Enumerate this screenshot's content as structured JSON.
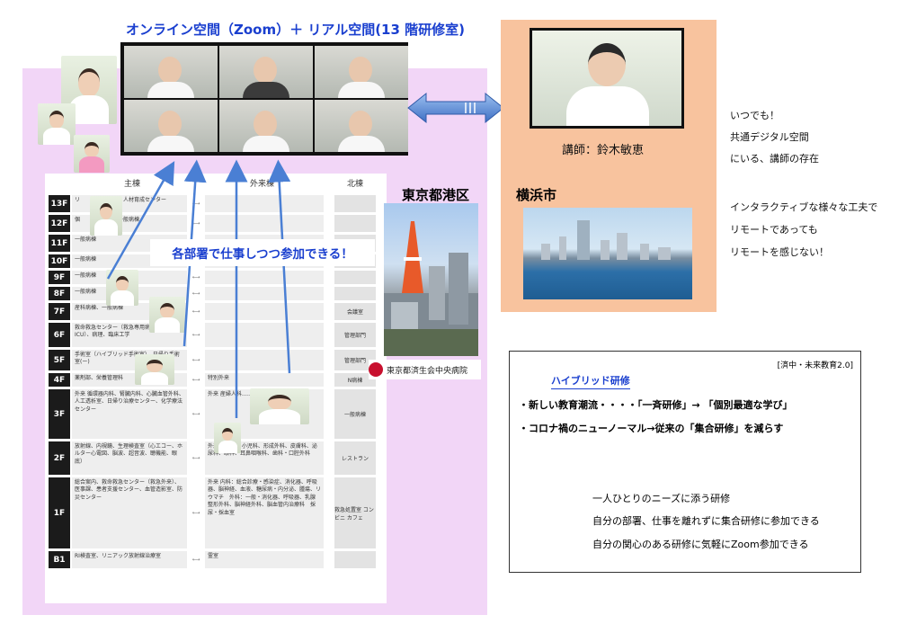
{
  "title": "オンライン空間（Zoom）＋ リアル空間(13 階研修室)",
  "callout": "各部署で仕事しつつ参加できる！",
  "lecturer": {
    "label": "講師：鈴木敏恵",
    "icon": "video-call-screen"
  },
  "yokohama": {
    "label": "横浜市"
  },
  "tokyo": {
    "label": "東京都港区",
    "hospital_logo": "東京都済生会中央病院"
  },
  "side_text": [
    "いつでも！",
    "共通デジタル空間",
    "にいる、講師の存在",
    "インタラクティブな様々な工夫で",
    "リモートであっても",
    "リモートを感じない！"
  ],
  "floor_map": {
    "headers": {
      "main": "主棟",
      "outpatient": "外来棟",
      "north": "北棟"
    },
    "floors": [
      {
        "label": "13F",
        "main": "リ　　　　り回廊、人材育成センター",
        "out": "",
        "north": ""
      },
      {
        "label": "12F",
        "main": "個　　　　　　　一般病棟",
        "out": "",
        "north": ""
      },
      {
        "label": "11F",
        "main": "一般病棟",
        "out": "",
        "north": ""
      },
      {
        "label": "10F",
        "main": "一般病棟",
        "out": "",
        "north": ""
      },
      {
        "label": "9F",
        "main": "一般病棟",
        "out": "",
        "north": ""
      },
      {
        "label": "8F",
        "main": "一般病棟",
        "out": "",
        "north": ""
      },
      {
        "label": "7F",
        "main": "産科病棟、一般病棟",
        "out": "",
        "north": "会議室"
      },
      {
        "label": "6F",
        "main": "救命救急センター（救急専用病棟、救命ICU）、病理、臨床工学",
        "out": "",
        "north": "管理部門"
      },
      {
        "label": "5F",
        "main": "手術室（ハイブリッド手術室）、日帰り手術室(ー)",
        "out": "",
        "north": "管理部門"
      },
      {
        "label": "4F",
        "main": "薬剤部、栄養管理科",
        "out": "特別外来",
        "north": "N病棟"
      },
      {
        "label": "3F",
        "main": "外来 循環器内科、腎臓内科、心臓血管外科、人工透析室、日帰り治療センター、化学療法センター",
        "out": "外来 産婦人科…… 総合……",
        "north": "一般病棟"
      },
      {
        "label": "2F",
        "main": "放射線、内視鏡、生理検査室（心エコー、ホルター心電図、脳波、超音波、聴機能、眼底）",
        "out": "外来 心療科、小児科、形成外科、皮膚科、泌尿科、眼科、耳鼻咽喉科、歯科・口腔外科",
        "north": "レストラン"
      },
      {
        "label": "1F",
        "main": "総合案内、救命救急センター（救急外来）、医事課、患者支援センター、血管造影室、防災センター",
        "out": "外来 内科：総合診療・感染症、消化器、呼吸器、脳神経、血液、糖尿病・内分泌、腫瘍、リウマチ　外科：一般・消化器、呼吸器、乳腺　整形外科、脳神経外科、脳血管内治療科　採尿・採血室",
        "north": "救急処置室 コンビニ カフェ"
      },
      {
        "label": "B1",
        "main": "RI検査室、リニアック放射線治療室",
        "out": "霊室",
        "north": ""
      }
    ]
  },
  "info_box": {
    "tag": "[済中・未来教育2.0]",
    "heading": "ハイブリッド研修",
    "bullets": [
      "・新しい教育潮流・・・・「一斉研修」→ 「個別最適な学び」",
      "・コロナ禍のニューノーマル→従来の「集合研修」を減らす"
    ],
    "notes": [
      "一人ひとりのニーズに添う研修",
      "自分の部署、仕事を離れずに集合研修に参加できる",
      "自分の関心のある研修に気軽にZoom参加できる"
    ]
  },
  "colors": {
    "title_blue": "#1a3fcf",
    "pink_bg": "#f2d6f7",
    "orange_bg": "#f8c39e",
    "arrow_blue": "#4a7fd4"
  }
}
